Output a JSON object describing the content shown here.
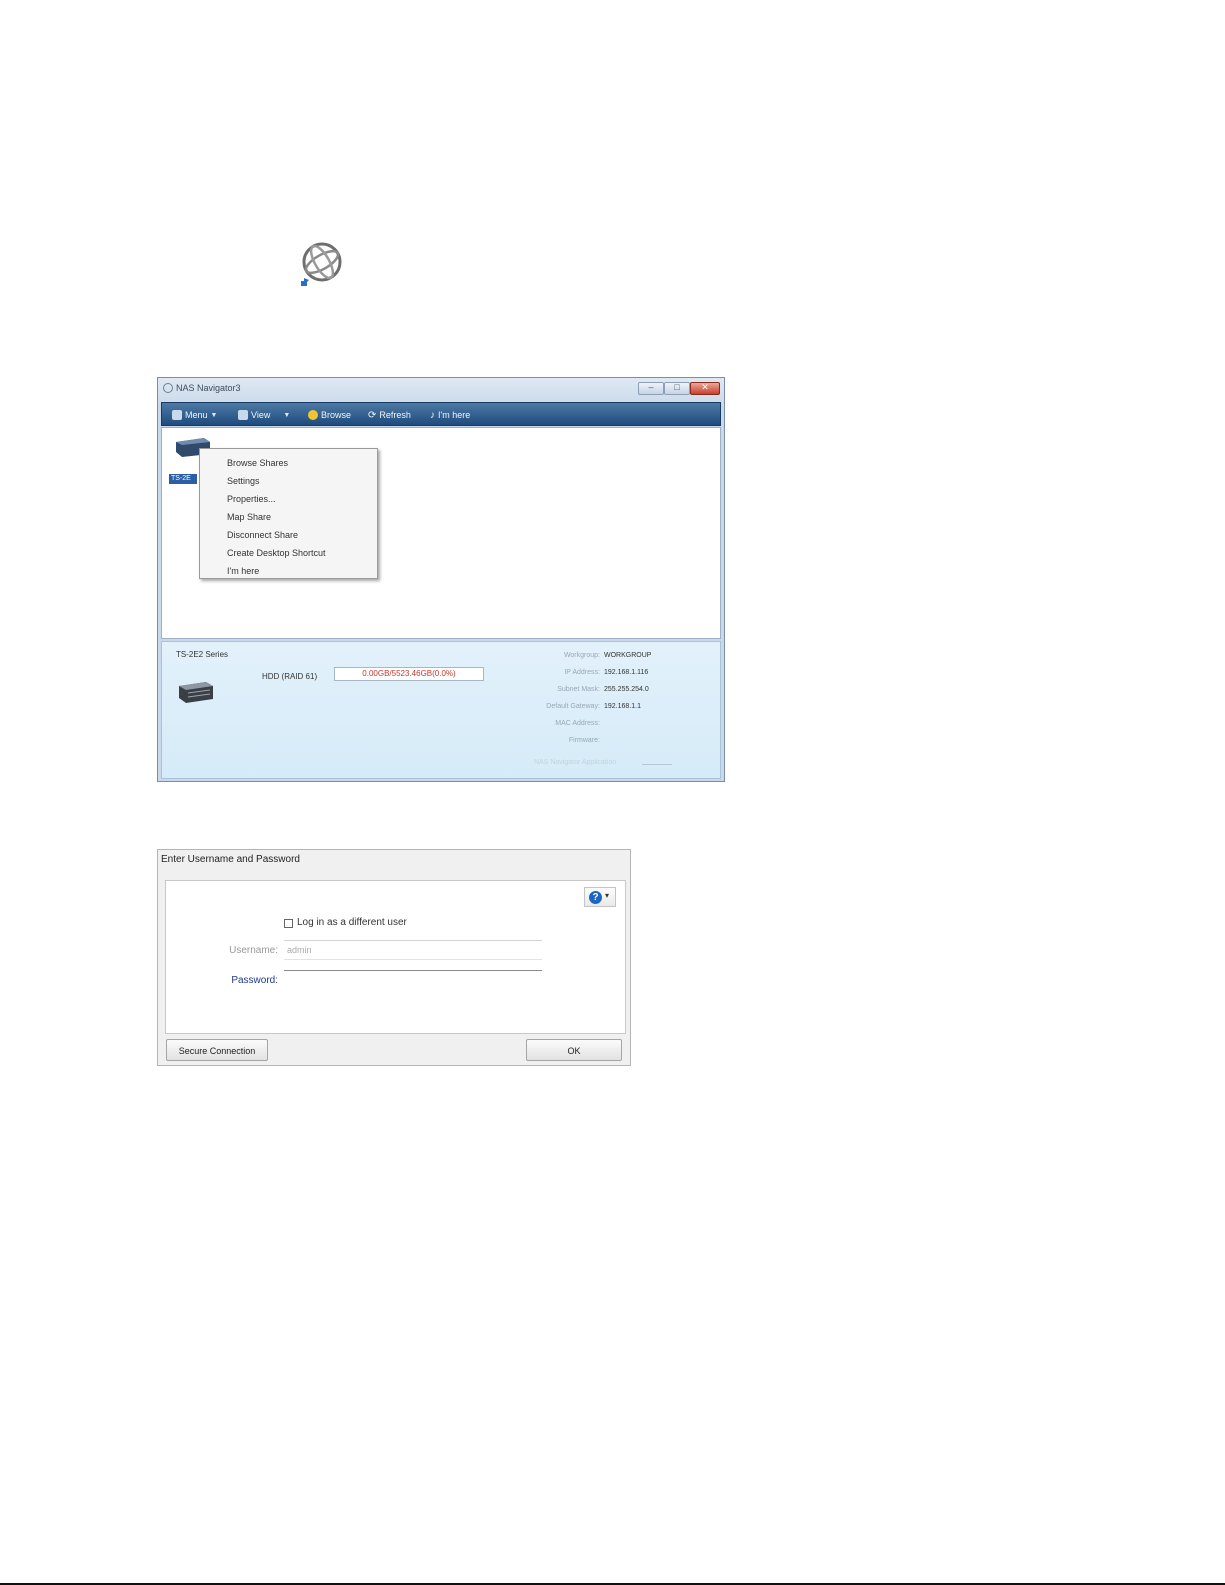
{
  "nas_window": {
    "title": "NAS Navigator3",
    "toolbar": {
      "menu": "Menu",
      "view": "View",
      "browse": "Browse",
      "refresh": "Refresh",
      "im_here": "I'm here"
    },
    "device_tag": "TS-2E",
    "context_menu": [
      "Browse Shares",
      "Settings",
      "Properties...",
      "Map Share",
      "Disconnect Share",
      "Create Desktop Shortcut",
      "I'm here"
    ],
    "info": {
      "model": "TS-2E2 Series",
      "hdd_label": "HDD (RAID 61)",
      "hdd_value": "0.00GB/5523.46GB(0.0%)",
      "fields": [
        {
          "key": "Workgroup:",
          "value": "WORKGROUP"
        },
        {
          "key": "IP Address:",
          "value": "192.168.1.116"
        },
        {
          "key": "Subnet Mask:",
          "value": "255.255.254.0"
        },
        {
          "key": "Default Gateway:",
          "value": "192.168.1.1"
        },
        {
          "key": "MAC Address:",
          "value": ""
        },
        {
          "key": "Firmware:",
          "value": ""
        }
      ],
      "footer": "NAS Navigator Application"
    }
  },
  "login_dialog": {
    "title": "Enter Username and Password",
    "different_user_label": "Log in as a different user",
    "username_label": "Username:",
    "username_value": "admin",
    "password_label": "Password:",
    "secure_button": "Secure Connection",
    "ok_button": "OK",
    "help_glyph": "?",
    "help_arrow": "▾"
  },
  "colors": {
    "toolbar": "#1f4c7e",
    "info_panel": "#d5ebf8",
    "hdd_value": "#c0392b",
    "help_icon": "#1c66c4"
  }
}
